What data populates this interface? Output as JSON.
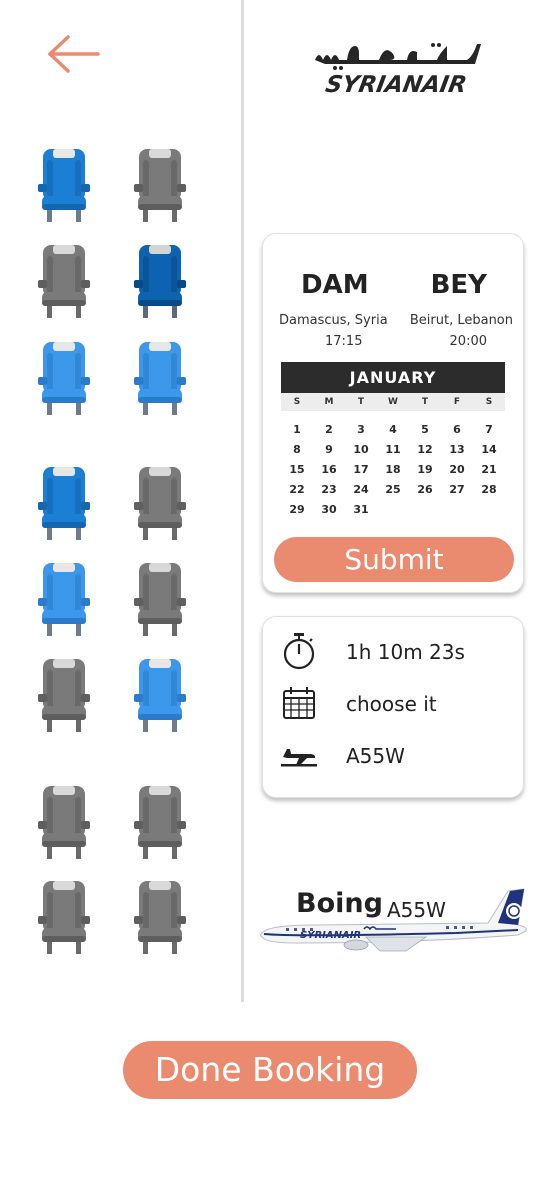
{
  "colors": {
    "accent": "#ea8b70",
    "seat_selected": "#1b7fd4",
    "seat_selected_light": "#3d98eb",
    "seat_dark": "#0d63b0",
    "seat_empty": "#7a7a7a",
    "calendar_header": "#2c2c2c"
  },
  "header": {
    "back_icon": "arrow-left-icon",
    "logo_arabic": "السورية",
    "logo_latin": "SYRIANAIR"
  },
  "seats": [
    {
      "row": 1,
      "side": "left",
      "state": "selected"
    },
    {
      "row": 1,
      "side": "right",
      "state": "empty"
    },
    {
      "row": 2,
      "side": "left",
      "state": "empty"
    },
    {
      "row": 2,
      "side": "right",
      "state": "dark"
    },
    {
      "row": 3,
      "side": "left",
      "state": "selected-light"
    },
    {
      "row": 3,
      "side": "right",
      "state": "selected-light"
    },
    {
      "row": 4,
      "side": "left",
      "state": "selected"
    },
    {
      "row": 4,
      "side": "right",
      "state": "empty"
    },
    {
      "row": 5,
      "side": "left",
      "state": "selected-light"
    },
    {
      "row": 5,
      "side": "right",
      "state": "empty"
    },
    {
      "row": 6,
      "side": "left",
      "state": "empty"
    },
    {
      "row": 6,
      "side": "right",
      "state": "selected-light"
    },
    {
      "row": 7,
      "side": "left",
      "state": "empty"
    },
    {
      "row": 7,
      "side": "right",
      "state": "empty"
    },
    {
      "row": 8,
      "side": "left",
      "state": "empty"
    },
    {
      "row": 8,
      "side": "right",
      "state": "empty"
    }
  ],
  "booking": {
    "from_code": "DAM",
    "to_code": "BEY",
    "from_city": "Damascus, Syria",
    "to_city": "Beirut, Lebanon",
    "from_time": "17:15",
    "to_time": "20:00",
    "calendar": {
      "month": "JANUARY",
      "weekdays": [
        "S",
        "M",
        "T",
        "W",
        "T",
        "F",
        "S"
      ],
      "days": [
        "1",
        "2",
        "3",
        "4",
        "5",
        "6",
        "7",
        "8",
        "9",
        "10",
        "11",
        "12",
        "13",
        "14",
        "15",
        "16",
        "17",
        "18",
        "19",
        "20",
        "21",
        "22",
        "23",
        "24",
        "25",
        "26",
        "27",
        "28",
        "29",
        "30",
        "31"
      ]
    },
    "submit_label": "Submit"
  },
  "info": {
    "duration": "1h 10m 23s",
    "duration_icon": "stopwatch-icon",
    "date": "choose it",
    "date_icon": "calendar-icon",
    "flight": "A55W",
    "flight_icon": "airplane-icon"
  },
  "aircraft": {
    "title": "Boing",
    "model": "A55W"
  },
  "done_label": "Done Booking"
}
